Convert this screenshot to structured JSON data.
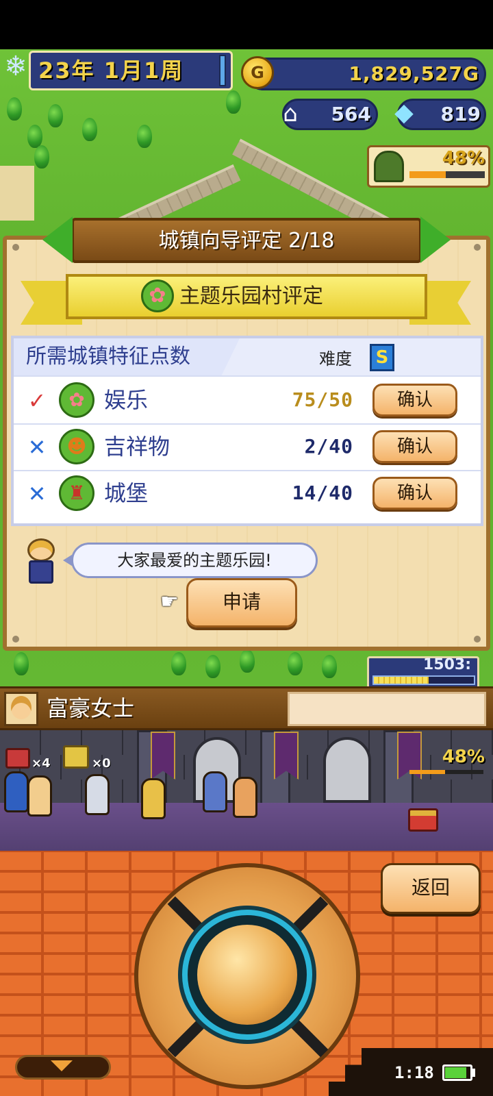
{
  "hud": {
    "date": "23年 1月1周",
    "gold": "1,829,527G",
    "gold_icon_letter": "G",
    "population": "564",
    "gems": "819",
    "entertainment_pct": "48%",
    "entertainment_level": 0.48,
    "timer": "1503:",
    "timer_level": 0.55
  },
  "panel": {
    "title": "城镇向导评定 2/18",
    "rank_title": "主题乐园村评定",
    "requirements_title": "所需城镇特征点数",
    "difficulty_label": "难度",
    "difficulty_grade": "S",
    "rows": [
      {
        "status": "✓",
        "icon": "ferris-wheel-icon",
        "label": "娱乐",
        "value": "75/50",
        "done": true,
        "button": "确认"
      },
      {
        "status": "✕",
        "icon": "mascot-icon",
        "label": "吉祥物",
        "value": "2/40",
        "done": false,
        "button": "确认"
      },
      {
        "status": "✕",
        "icon": "castle-icon",
        "label": "城堡",
        "value": "14/40",
        "done": false,
        "button": "确认"
      }
    ],
    "speech": "大家最爱的主题乐园!",
    "apply_button": "申请"
  },
  "character": {
    "name": "富豪女士"
  },
  "dungeon": {
    "chest_red_count": "×4",
    "chest_gold_count": "×0",
    "progress_pct": "48%",
    "progress_level": 0.48
  },
  "controls": {
    "back_button": "返回"
  },
  "system": {
    "clock": "1:18",
    "battery_level": 0.85
  },
  "colors": {
    "accent_gold": "#f3d34b",
    "hud_navy": "#2b3a7a",
    "button_orange": "#f4b36a",
    "check_red": "#d93a3a",
    "cross_blue": "#2a6cd6"
  }
}
